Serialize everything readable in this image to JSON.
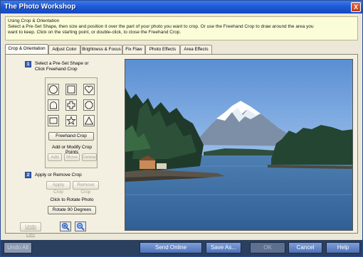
{
  "window": {
    "title": "The Photo Workshop",
    "close_glyph": "X"
  },
  "info": {
    "heading": "Using Crop & Orientation",
    "line1": "Select a Pre-Set Shape, then size and position it over the part of your photo you want to crop.  Or use the Freehand Crop to draw around the area you",
    "line2": "want to keep.  Click on the starting point, or double-click, to close the Freehand Crop."
  },
  "tabs": [
    {
      "label": "Crop & Orientation"
    },
    {
      "label": "Adjust Color"
    },
    {
      "label": "Brightness & Focus"
    },
    {
      "label": "Fix Flaw"
    },
    {
      "label": "Photo Effects"
    },
    {
      "label": "Area Effects"
    }
  ],
  "step1": {
    "num": "1",
    "line1": "Select a Pre-Set Shape or",
    "line2": "Click Freehand Crop"
  },
  "shapes": [
    "circle",
    "square",
    "heart",
    "arch",
    "cross",
    "octagon",
    "rectangle",
    "star",
    "triangle"
  ],
  "freehand_label": "Freehand Crop",
  "crop_points": {
    "label": "Add or Modify Crop Points",
    "add": "Add",
    "move": "Move",
    "delete": "Delete"
  },
  "step2": {
    "num": "2",
    "label": "Apply or Remove Crop",
    "apply": "Apply Crop",
    "remove": "Remove Crop"
  },
  "rotate": {
    "label": "Click to Rotate Photo",
    "button": "Rotate 90 Degrees"
  },
  "undo_last": "Undo Last",
  "zoom": {
    "in_icon": "zoom-in-icon",
    "out_icon": "zoom-out-icon"
  },
  "bottom": {
    "undo_all": "Undo All",
    "send_online": "Send Online",
    "save_as": "Save As...",
    "ok": "OK",
    "cancel": "Cancel",
    "help": "Help"
  },
  "colors": {
    "title_bar": "#1f5ad6",
    "bottom_bar": "#2b3f5e",
    "button_blue": "#5a7ec2"
  }
}
